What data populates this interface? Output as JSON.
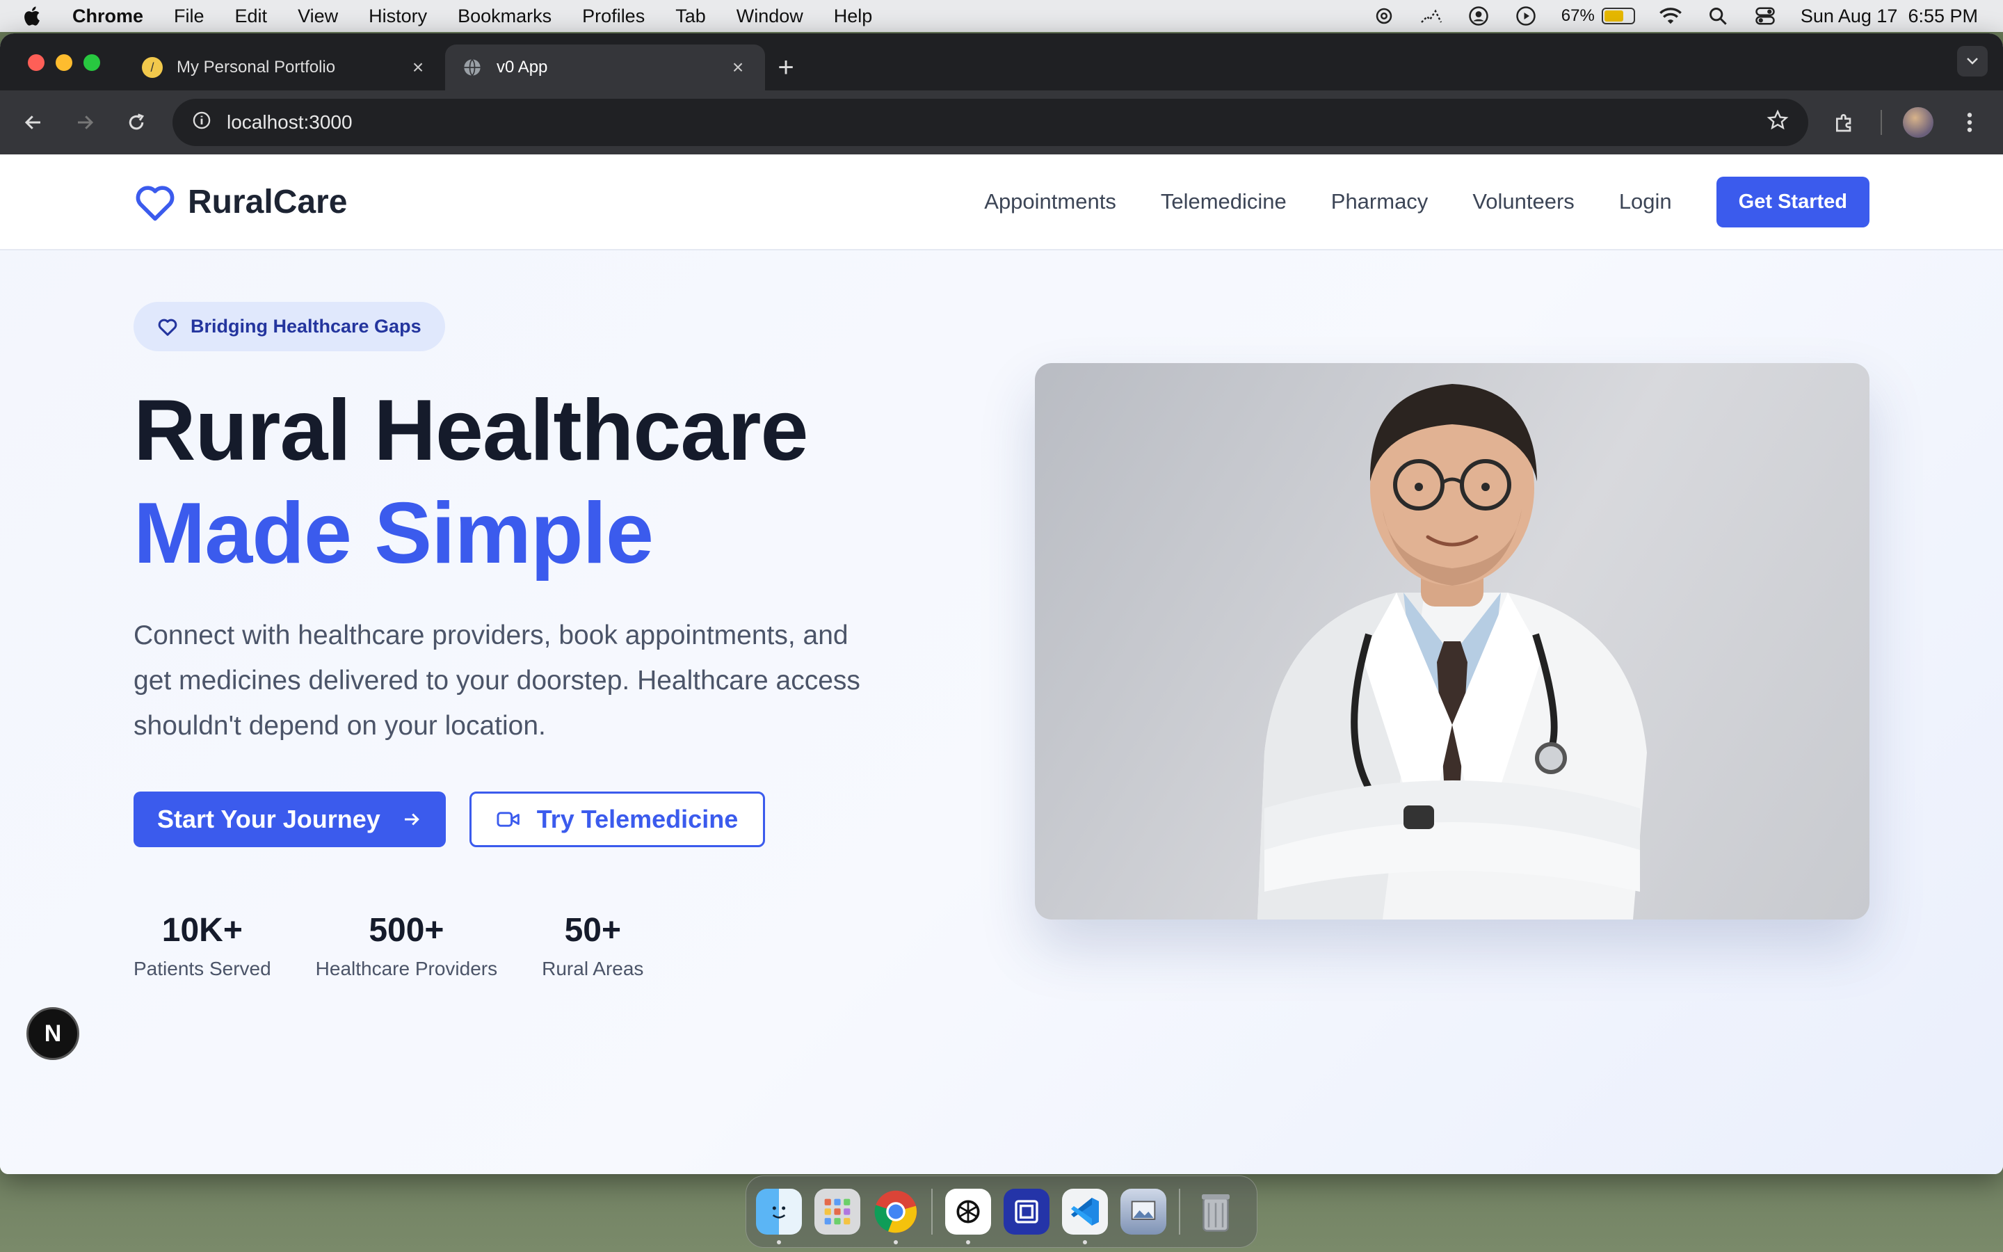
{
  "menubar": {
    "app_name": "Chrome",
    "items": [
      "File",
      "Edit",
      "View",
      "History",
      "Bookmarks",
      "Profiles",
      "Tab",
      "Window",
      "Help"
    ],
    "battery": "67%",
    "clock": "Sun Aug 17  6:55 PM"
  },
  "browser": {
    "tabs": [
      {
        "title": "My Personal Portfolio",
        "active": false
      },
      {
        "title": "v0 App",
        "active": true
      }
    ],
    "url": "localhost:3000"
  },
  "site": {
    "brand": "RuralCare",
    "nav": [
      "Appointments",
      "Telemedicine",
      "Pharmacy",
      "Volunteers",
      "Login"
    ],
    "get_started": "Get Started",
    "badge": "Bridging Healthcare Gaps",
    "headline_1": "Rural Healthcare",
    "headline_2": "Made Simple",
    "lead": "Connect with healthcare providers, book appointments, and get medicines delivered to your doorstep. Healthcare access shouldn't depend on your location.",
    "cta_primary": "Start Your Journey",
    "cta_secondary": "Try Telemedicine",
    "stats": [
      {
        "value": "10K+",
        "label": "Patients Served"
      },
      {
        "value": "500+",
        "label": "Healthcare Providers"
      },
      {
        "value": "50+",
        "label": "Rural Areas"
      }
    ],
    "next_badge": "N"
  },
  "colors": {
    "accent": "#3b5bed",
    "heading": "#151b2b",
    "body_text": "#4b5468"
  },
  "dock": [
    "finder-icon",
    "launchpad-icon",
    "chrome-icon",
    "chatgpt-icon",
    "screen-tool-icon",
    "vscode-icon",
    "preview-icon",
    "trash-icon"
  ]
}
